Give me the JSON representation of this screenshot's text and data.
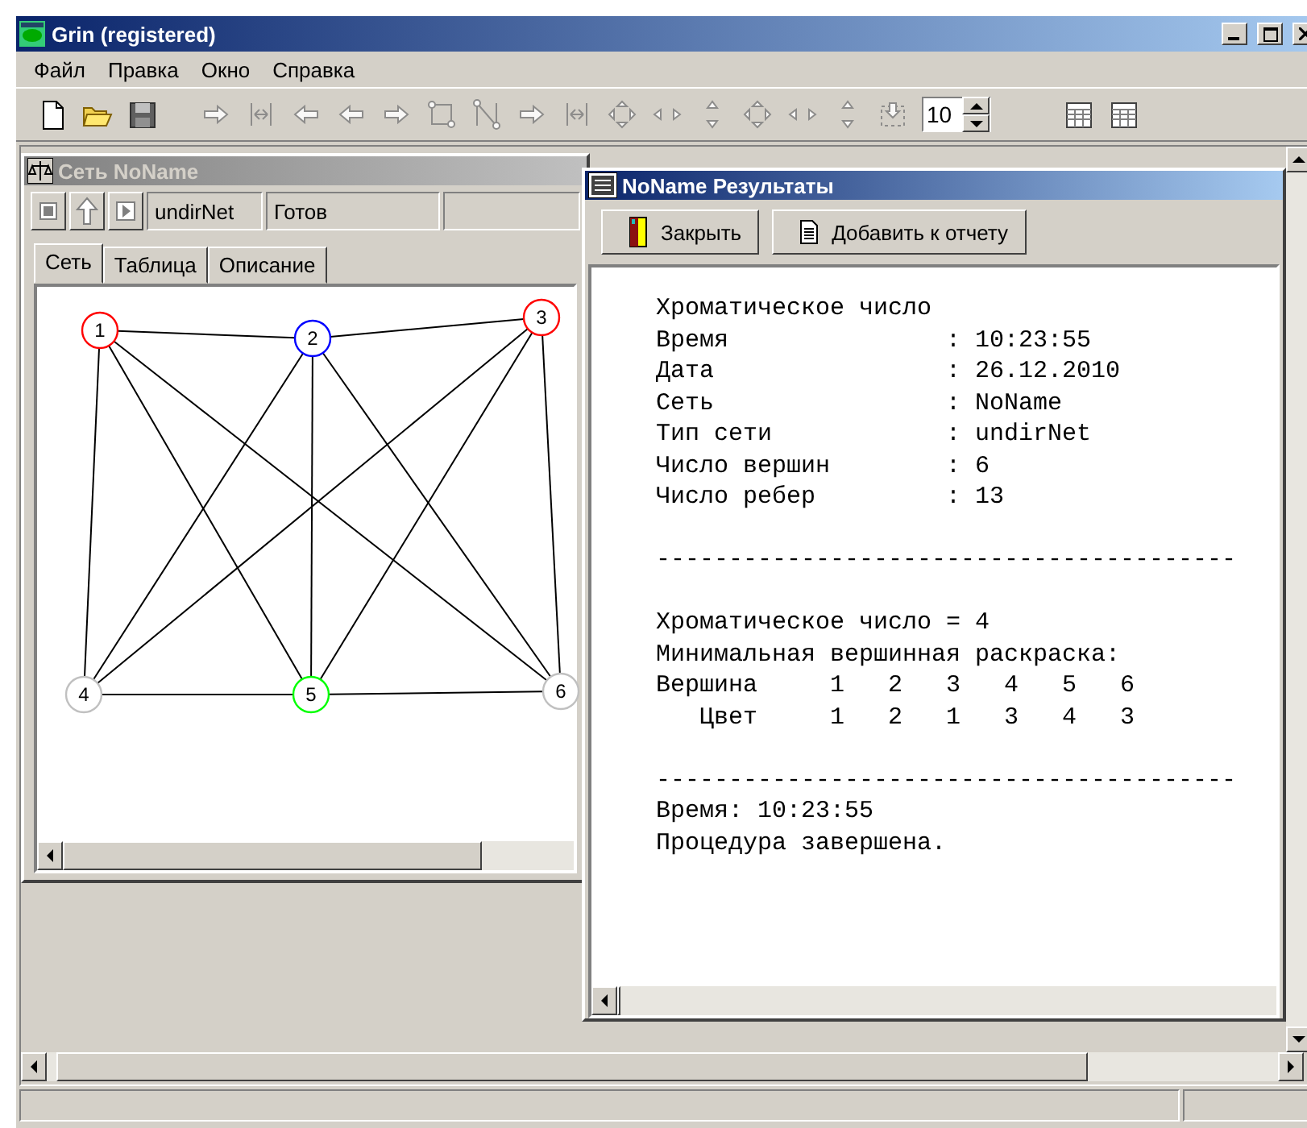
{
  "window": {
    "title": "Grin (registered)"
  },
  "menu": [
    {
      "label": "Файл"
    },
    {
      "label": "Правка"
    },
    {
      "label": "Окно"
    },
    {
      "label": "Справка"
    }
  ],
  "toolbar": {
    "tools": [
      {
        "kind": "new",
        "disabled": false
      },
      {
        "kind": "open",
        "disabled": false
      },
      {
        "kind": "save",
        "disabled": false
      },
      {
        "kind": "arrow-right",
        "disabled": true
      },
      {
        "kind": "bracket",
        "disabled": true
      },
      {
        "kind": "arrow-left",
        "disabled": true
      },
      {
        "kind": "arrow-left",
        "disabled": true
      },
      {
        "kind": "arrow-right",
        "disabled": true
      },
      {
        "kind": "frame",
        "disabled": true
      },
      {
        "kind": "zigzag",
        "disabled": true
      },
      {
        "kind": "arrow-right",
        "disabled": true
      },
      {
        "kind": "bracket",
        "disabled": true
      },
      {
        "kind": "move",
        "disabled": true
      },
      {
        "kind": "arrows-h",
        "disabled": true
      },
      {
        "kind": "arrows-v",
        "disabled": true
      },
      {
        "kind": "move",
        "disabled": true
      },
      {
        "kind": "arrows-h",
        "disabled": true
      },
      {
        "kind": "arrows-v",
        "disabled": true
      },
      {
        "kind": "box",
        "disabled": true
      }
    ],
    "spinner_value": "10",
    "tail_tools": [
      {
        "kind": "table",
        "disabled": false
      },
      {
        "kind": "table",
        "disabled": false
      }
    ]
  },
  "network_window": {
    "title": "Сеть NoName",
    "active": false,
    "net_type": "undirNet",
    "status": "Готов",
    "tabs": [
      {
        "label": "Сеть",
        "selected": true
      },
      {
        "label": "Таблица",
        "selected": false
      },
      {
        "label": "Описание",
        "selected": false
      }
    ],
    "nodes": [
      {
        "label": "1",
        "color": "#ff0000"
      },
      {
        "label": "2",
        "color": "#0000ff"
      },
      {
        "label": "3",
        "color": "#ff0000"
      },
      {
        "label": "4",
        "color": "#c0c0c0"
      },
      {
        "label": "5",
        "color": "#00ff00"
      },
      {
        "label": "6",
        "color": "#c0c0c0"
      }
    ]
  },
  "results_window": {
    "title": "NoName Результаты",
    "active": true,
    "buttons": [
      {
        "kind": "close",
        "label": "Закрыть"
      },
      {
        "kind": "report",
        "label": "Добавить к отчету"
      }
    ],
    "blocks": [
      [
        "Хроматическое число",
        "Время               : 10:23:55",
        "Дата                : 26.12.2010",
        "Сеть                : NoName",
        "Тип сети            : undirNet",
        "Число вершин        : 6",
        "Число ребер         : 13"
      ],
      [
        "----------------------------------------"
      ],
      [
        "Хроматическое число = 4",
        "Минимальная вершинная раскраска:",
        "Вершина     1   2   3   4   5   6",
        "   Цвет     1   2   1   3   4   3"
      ],
      [
        "----------------------------------------",
        "Время: 10:23:55",
        "Процедура завершена."
      ]
    ]
  }
}
